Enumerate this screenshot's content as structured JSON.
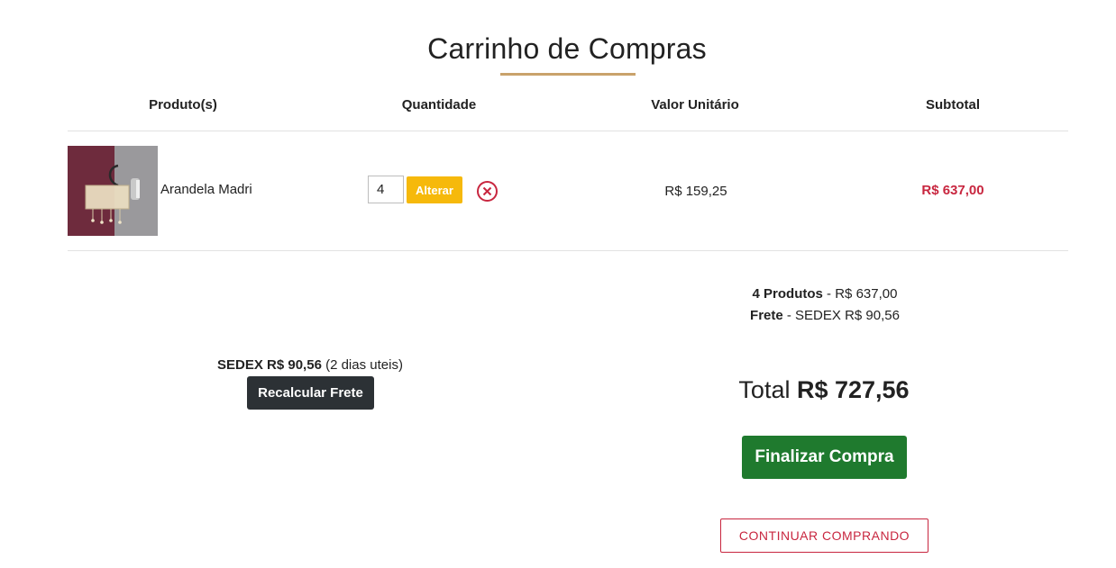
{
  "page": {
    "title": "Carrinho de Compras"
  },
  "colors": {
    "accent_underline": "#c9a26b",
    "price_red": "#c8263f",
    "alter_yellow": "#f6b90b",
    "finalize_green": "#1f7a2e",
    "recalc_dark": "#2c3135"
  },
  "table": {
    "headers": [
      "Produto(s)",
      "Quantidade",
      "Valor Unitário",
      "Subtotal"
    ]
  },
  "cart_items": [
    {
      "name": "Arandela Madri",
      "quantity": "4",
      "alter_label": "Alterar",
      "remove_icon": "circle-x-icon",
      "unit_price": "R$ 159,25",
      "subtotal": "R$ 637,00"
    }
  ],
  "summary": {
    "products_label": "4 Produtos",
    "products_value": " - R$ 637,00",
    "shipping_label": "Frete",
    "shipping_value": " - SEDEX R$ 90,56",
    "total_label": "Total ",
    "total_value": "R$ 727,56"
  },
  "shipping": {
    "method": "SEDEX R$ 90,56",
    "delivery_time": " (2 dias uteis)",
    "recalc_label": "Recalcular Frete"
  },
  "actions": {
    "finalize_label": "Finalizar Compra",
    "continue_label": "CONTINUAR COMPRANDO"
  }
}
